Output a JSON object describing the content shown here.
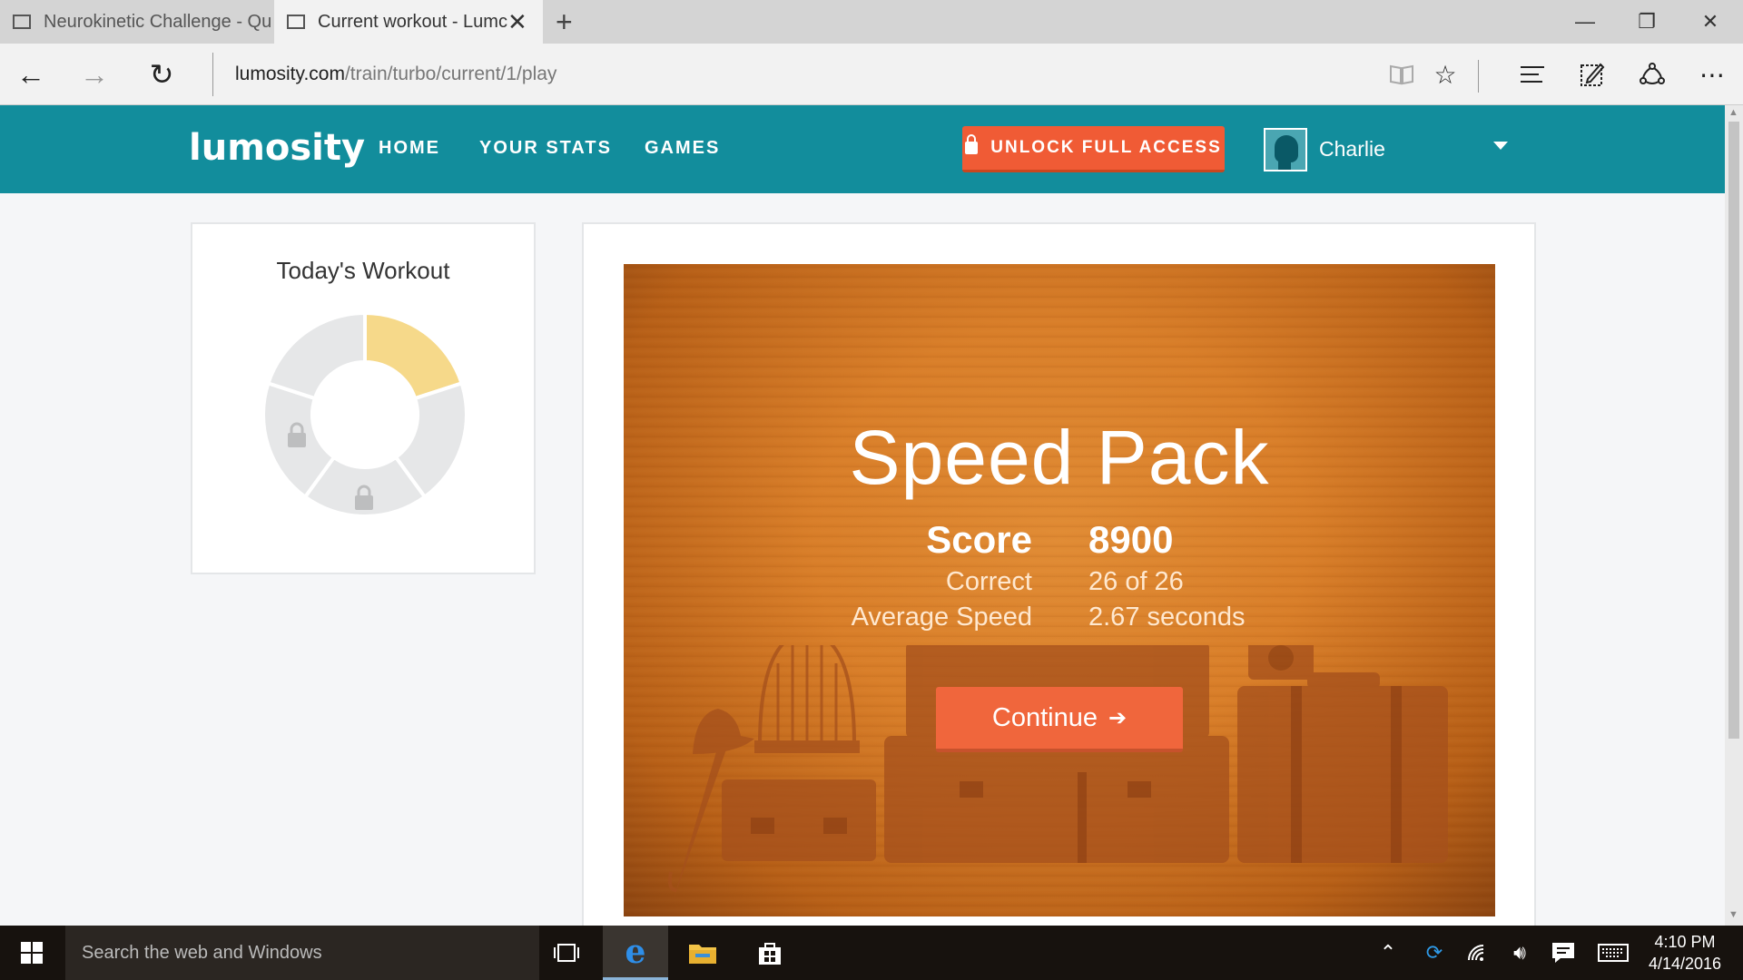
{
  "browser": {
    "tabs": [
      {
        "label": "Neurokinetic Challenge - Qu"
      },
      {
        "label": "Current workout - Lumc"
      }
    ],
    "url_domain": "lumosity.com",
    "url_path": "/train/turbo/current/1/play"
  },
  "site": {
    "logo": "lumosity",
    "nav": [
      "HOME",
      "YOUR STATS",
      "GAMES"
    ],
    "unlock_label": "UNLOCK FULL ACCESS",
    "user_name": "Charlie",
    "colors": {
      "header": "#128d9c",
      "unlock": "#f05b35"
    }
  },
  "workout": {
    "title": "Today's Workout",
    "segments": [
      {
        "state": "completed",
        "color": "#f6d98a"
      },
      {
        "state": "pending",
        "color": "#e6e7e8"
      },
      {
        "state": "locked",
        "color": "#e6e7e8"
      },
      {
        "state": "locked",
        "color": "#e6e7e8"
      },
      {
        "state": "pending",
        "color": "#e6e7e8"
      }
    ]
  },
  "game": {
    "title": "Speed Pack",
    "score_label": "Score",
    "score_value": "8900",
    "correct_label": "Correct",
    "correct_value": "26 of 26",
    "speed_label": "Average Speed",
    "speed_value": "2.67 seconds",
    "continue_label": "Continue"
  },
  "taskbar": {
    "search_placeholder": "Search the web and Windows",
    "time": "4:10 PM",
    "date": "4/14/2016"
  }
}
